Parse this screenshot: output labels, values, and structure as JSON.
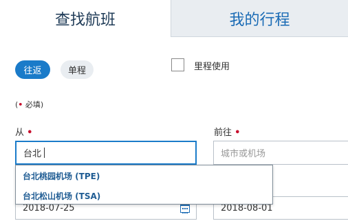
{
  "tabs": {
    "search": "查找航班",
    "my_trips": "我的行程"
  },
  "trip_type": {
    "round_trip": "往返",
    "one_way": "单程"
  },
  "miles": {
    "label": "里程使用",
    "checked": false
  },
  "required_note": {
    "open": "(",
    "dot": "•",
    "text": " 必填)"
  },
  "from": {
    "label": "从",
    "required_dot": "•",
    "value": "台北"
  },
  "to": {
    "label": "前往",
    "required_dot": "•",
    "placeholder": "城市或机场"
  },
  "autocomplete": [
    "台北桃园机场 (TPE)",
    "台北松山机场 (TSA)"
  ],
  "dates": {
    "depart": "2018-07-25",
    "return": "2018-08-01"
  },
  "colors": {
    "accent": "#1a7bc9",
    "required": "#c8102e",
    "link": "#1a6bb5"
  }
}
